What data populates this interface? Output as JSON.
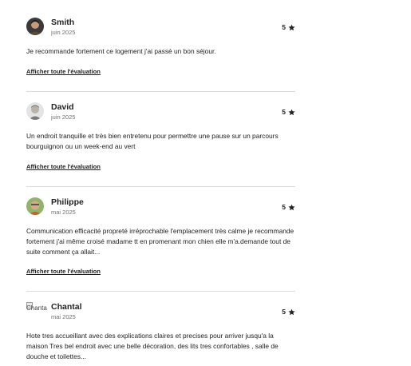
{
  "reviews": [
    {
      "author": "Smith",
      "date": "juin 2025",
      "rating": "5",
      "text": "Je recommande fortement ce logement j'ai passé un bon séjour.",
      "link": "Afficher toute l'évaluation",
      "avatar_icon": "user-photo-smith"
    },
    {
      "author": "David",
      "date": "juin 2025",
      "rating": "5",
      "text": "Un endroit tranquille et très bien entretenu pour permettre une pause sur un parcours bourguignon ou un week-end au vert",
      "link": "Afficher toute l'évaluation",
      "avatar_icon": "user-photo-david"
    },
    {
      "author": "Philippe",
      "date": "mai 2025",
      "rating": "5",
      "text": "Communication efficacité propreté irréprochable l'emplacement très calme je recommande fortement j'ai même croisé madame tt en promenant mon chien elle m'a.demande tout de suite comment ça allait...",
      "link": "Afficher toute l'évaluation",
      "avatar_icon": "user-photo-philippe"
    },
    {
      "author": "Chantal",
      "date": "mai 2025",
      "rating": "5",
      "text": "Hote tres accueillant avec des explications claires et precises pour arriver jusqu'a la maison Tres bel endroit avec une belle décoration, des lits tres confortables , salle de douche et toilettes...",
      "avatar_alt": "Chantal",
      "avatar_icon": "broken-image-icon"
    }
  ],
  "star_icon": "star-icon",
  "colors": {
    "text": "#222222",
    "muted": "#717171",
    "divider": "#dddddd"
  }
}
